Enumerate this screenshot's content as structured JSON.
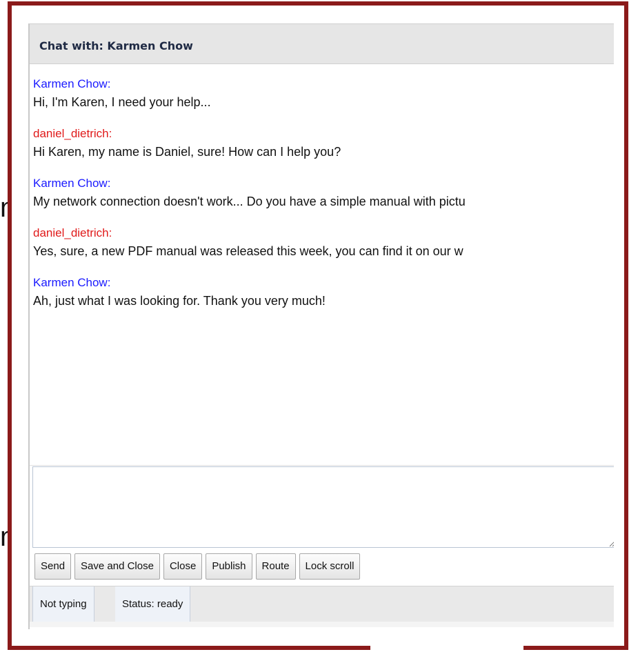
{
  "background_fragments": [
    "n",
    "n"
  ],
  "window": {
    "title": "Chat with: Karmen Chow"
  },
  "messages": [
    {
      "sender": "Karmen Chow:",
      "role": "customer",
      "text": "Hi, I'm Karen, I need your help..."
    },
    {
      "sender": "daniel_dietrich:",
      "role": "agent",
      "text": "Hi Karen, my name is Daniel, sure! How can I help you?"
    },
    {
      "sender": "Karmen Chow:",
      "role": "customer",
      "text": "My network connection doesn't work... Do you have a simple manual with pictu"
    },
    {
      "sender": "daniel_dietrich:",
      "role": "agent",
      "text": "Yes, sure, a new PDF manual was released this week, you can find it on our w"
    },
    {
      "sender": "Karmen Chow:",
      "role": "customer",
      "text": "Ah, just what I was looking for. Thank you very much!"
    }
  ],
  "input": {
    "value": ""
  },
  "toolbar": {
    "send": "Send",
    "save_and_close": "Save and Close",
    "close": "Close",
    "publish": "Publish",
    "route": "Route",
    "lock_scroll": "Lock scroll"
  },
  "status": {
    "typing": "Not typing",
    "state": "Status: ready"
  },
  "colors": {
    "customer": "#1a1aff",
    "agent": "#e01a1a",
    "frame": "#8b1a1a"
  }
}
